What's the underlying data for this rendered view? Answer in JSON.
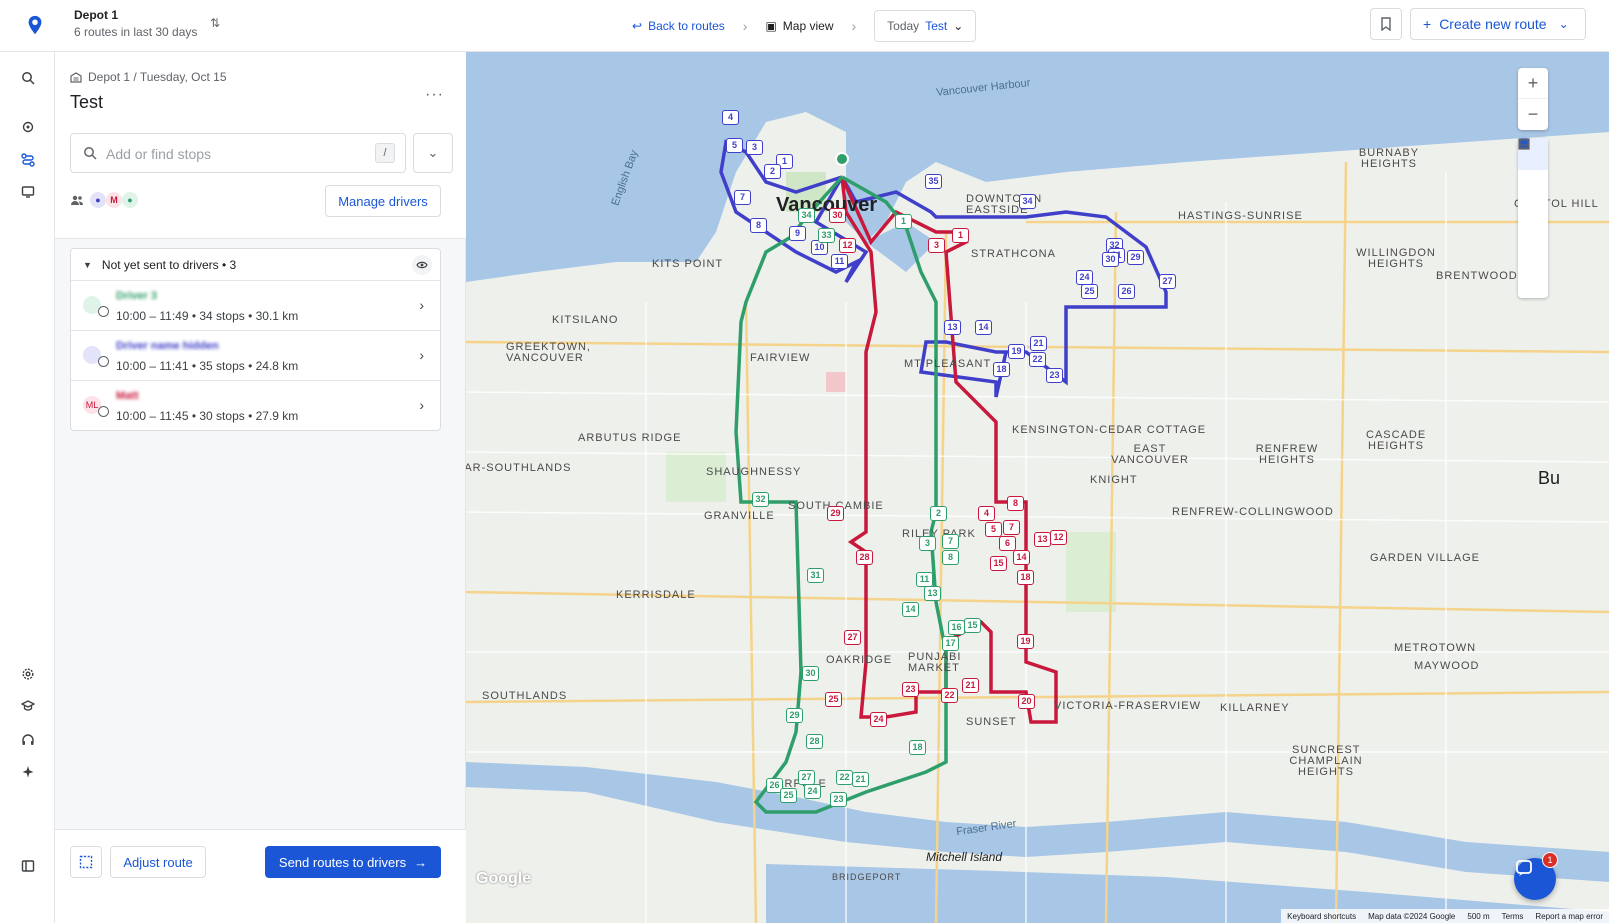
{
  "header": {
    "depot_name": "Depot 1",
    "depot_subtitle": "6 routes in last 30 days",
    "back_label": "Back to routes",
    "map_view_label": "Map view",
    "date_label": "Today",
    "date_value": "Test",
    "create_label": "Create new route"
  },
  "panel": {
    "breadcrumb": "Depot 1 / Tuesday, Oct 15",
    "title": "Test",
    "more": "···",
    "search_placeholder": "Add or find stops",
    "search_shortcut": "/",
    "avatar_m": "M",
    "manage_label": "Manage drivers",
    "group_label": "Not yet sent to drivers • 3",
    "routes": [
      {
        "name": "Driver 3",
        "info": "10:00 – 11:49 • 34 stops • 30.1 km",
        "initials": "",
        "color": "#2e9e6a"
      },
      {
        "name": "Driver name hidden",
        "info": "10:00 – 11:41 • 35 stops • 24.8 km",
        "initials": "",
        "color": "#3f3fc9"
      },
      {
        "name": "Matt",
        "info": "10:00 – 11:45 • 30 stops • 27.9 km",
        "initials": "ML",
        "color": "#c8193c"
      }
    ],
    "adjust_label": "Adjust route",
    "send_label": "Send routes to drivers"
  },
  "map": {
    "labels": {
      "vancouver": "Vancouver",
      "harbour": "Vancouver Harbour",
      "english_bay": "English Bay",
      "downtown": "DOWNTOWN EASTSIDE",
      "strathcona": "STRATHCONA",
      "kits_point": "KITS POINT",
      "kitsilano": "KITSILANO",
      "greektown": "GREEKTOWN, VANCOUVER",
      "fairview": "FAIRVIEW",
      "mt_pleasant": "MT PLEASANT",
      "arbutus": "ARBUTUS RIDGE",
      "shaughnessy": "SHAUGHNESSY",
      "bar_south": "BAR-SOUTHLANDS",
      "granville": "GRANVILLE",
      "south_cambie": "SOUTH CAMBIE",
      "riley_park": "RILEY PARK",
      "kerrisdale": "KERRISDALE",
      "oakridge": "OAKRIDGE",
      "punjabi": "PUNJABI MARKET",
      "sunset": "SUNSET",
      "southlands": "SOUTHLANDS",
      "marpole": "MARPOLE",
      "kensington": "KENSINGTON-CEDAR COTTAGE",
      "east_van": "EAST VANCOUVER",
      "knight": "KNIGHT",
      "renfrew_heights": "RENFREW HEIGHTS",
      "renfrew_coll": "RENFREW-COLLINGWOOD",
      "victoria": "VICTORIA-FRASERVIEW",
      "killarney": "KILLARNEY",
      "hastings": "HASTINGS-SUNRISE",
      "burnaby_heights": "BURNABY HEIGHTS",
      "capitol_hill": "CAPITOL HILL",
      "willingdon": "WILLINGDON HEIGHTS",
      "brentwood": "BRENTWOOD",
      "cascade": "CASCADE HEIGHTS",
      "garden_village": "GARDEN VILLAGE",
      "metrotown": "METROTOWN",
      "maywood": "MAYWOOD",
      "suncrest": "SUNCREST",
      "champlain": "CHAMPLAIN HEIGHTS",
      "mitchell": "Mitchell Island",
      "bridgeport": "BRIDGEPORT",
      "fraser_river": "Fraser River",
      "burnaby_short": "Bu"
    },
    "zoom_in": "+",
    "zoom_out": "−",
    "google": "Google",
    "footer": [
      "Keyboard shortcuts",
      "Map data ©2024 Google",
      "500 m",
      "Terms",
      "Report a map error"
    ],
    "chat_badge": "1"
  }
}
